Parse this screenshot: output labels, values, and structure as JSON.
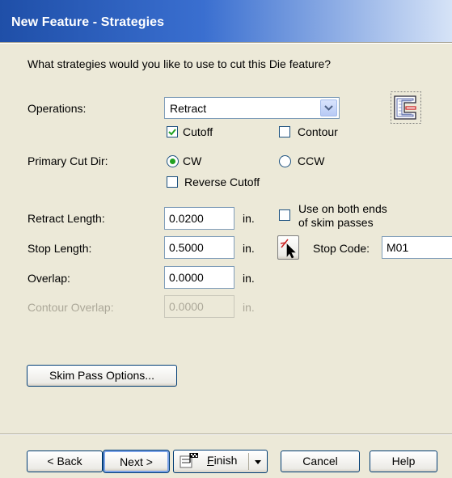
{
  "dialog": {
    "title": "New Feature - Strategies",
    "question": "What strategies would you like to use to cut this Die feature?"
  },
  "operations": {
    "label": "Operations:",
    "selected": "Retract",
    "cutoff_label": "Cutoff",
    "cutoff_checked": true,
    "contour_label": "Contour",
    "contour_checked": false
  },
  "primary_cut_dir": {
    "label": "Primary Cut Dir:",
    "cw_label": "CW",
    "ccw_label": "CCW",
    "selected": "CW",
    "reverse_cutoff_label": "Reverse Cutoff",
    "reverse_cutoff_checked": false
  },
  "params": {
    "retract_length_label": "Retract Length:",
    "retract_length_value": "0.0200",
    "stop_length_label": "Stop Length:",
    "stop_length_value": "0.5000",
    "overlap_label": "Overlap:",
    "overlap_value": "0.0000",
    "contour_overlap_label": "Contour Overlap:",
    "contour_overlap_value": "0.0000",
    "unit": "in."
  },
  "skim": {
    "use_both_ends_line1": "Use on both ends",
    "use_both_ends_line2": "of skim passes",
    "use_both_ends_checked": false,
    "stop_code_label": "Stop Code:",
    "stop_code_value": "M01",
    "options_button": "Skim Pass Options..."
  },
  "footer": {
    "back": "< Back",
    "next": "Next >",
    "finish_prefix": "",
    "finish_underlined": "F",
    "finish_rest": "inish",
    "cancel": "Cancel",
    "help": "Help"
  },
  "icons": {
    "feature": "die-feature-icon",
    "stop_code": "stop-code-pick-icon",
    "finish": "finish-icon",
    "dropdown": "chevron-down-icon"
  }
}
